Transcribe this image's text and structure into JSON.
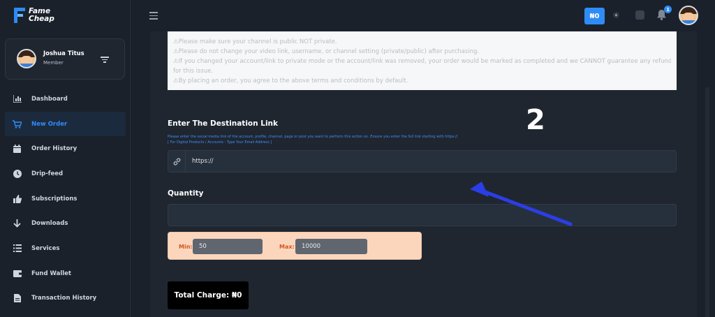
{
  "brand": {
    "line1": "Fame",
    "line2": "Cheap"
  },
  "user": {
    "name": "Joshua Titus",
    "role": "Member"
  },
  "nav": [
    {
      "label": "Dashboard",
      "icon": "chart-icon"
    },
    {
      "label": "New Order",
      "icon": "cart-icon",
      "active": true
    },
    {
      "label": "Order History",
      "icon": "calendar-icon"
    },
    {
      "label": "Drip-feed",
      "icon": "clock-icon"
    },
    {
      "label": "Subscriptions",
      "icon": "thumbs-up-icon"
    },
    {
      "label": "Downloads",
      "icon": "arrow-down-icon"
    },
    {
      "label": "Services",
      "icon": "list-icon"
    },
    {
      "label": "Fund Wallet",
      "icon": "wallet-icon"
    },
    {
      "label": "Transaction History",
      "icon": "file-icon"
    }
  ],
  "topbar": {
    "balance": "₦0",
    "notifications": "1"
  },
  "notice": {
    "lines": [
      "⚠Please make sure your channel is public NOT private.",
      "⚠Please do not change your video link, username, or channel setting (private/public) after purchasing.",
      "⚠If you changed your account/link to private mode or the account/link was removed, your order would be marked as completed and we CANNOT guarantee any refund",
      "for this issue.",
      "⚠By placing an order, you agree to the above terms and conditions by default."
    ]
  },
  "form": {
    "destination_label": "Enter The Destination Link",
    "hint_line1": "Please enter the social media link of the account, profile, channel, page or post you want to perform this action on. Ensure you enter the full link starting with https://",
    "hint_line2": "[ For Digital Products / Accounts - Type Your Email Address ]",
    "link_value": "https://",
    "quantity_label": "Quantity",
    "min_label": "Min:",
    "min_value": "50",
    "max_label": "Max:",
    "max_value": "10000",
    "total_label": "Total Charge: ₦0"
  },
  "annotation": {
    "step_number": "2",
    "arrow_color": "#2b3ee6"
  }
}
